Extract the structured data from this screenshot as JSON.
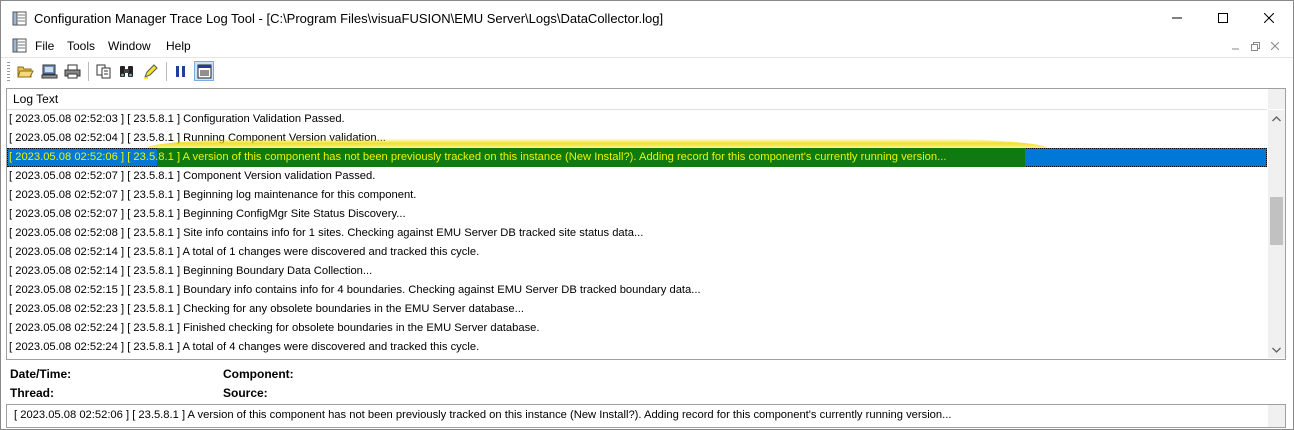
{
  "window": {
    "title": "Configuration Manager Trace Log Tool - [C:\\Program Files\\visuaFUSION\\EMU Server\\Logs\\DataCollector.log]"
  },
  "menu": {
    "items": [
      {
        "label": "File"
      },
      {
        "label": "Tools"
      },
      {
        "label": "Window"
      },
      {
        "label": "Help"
      }
    ]
  },
  "list": {
    "column_header": "Log Text",
    "rows": [
      {
        "text": "[ 2023.05.08 02:52:03 ] [ 23.5.8.1 ] Configuration Validation Passed."
      },
      {
        "text": "[ 2023.05.08 02:52:04 ] [ 23.5.8.1 ] Running Component Version validation..."
      },
      {
        "text": "[ 2023.05.08 02:52:06 ] [ 23.5.8.1 ] A version of this component has not been previously tracked on this instance (New Install?).  Adding record for this component's currently running version...",
        "selected": true
      },
      {
        "text": "[ 2023.05.08 02:52:07 ] [ 23.5.8.1 ] Component Version validation Passed."
      },
      {
        "text": "[ 2023.05.08 02:52:07 ] [ 23.5.8.1 ] Beginning log maintenance for this component."
      },
      {
        "text": "[ 2023.05.08 02:52:07 ] [ 23.5.8.1 ] Beginning ConfigMgr Site Status Discovery..."
      },
      {
        "text": "[ 2023.05.08 02:52:08 ] [ 23.5.8.1 ] Site info contains info for 1 sites.  Checking against EMU Server DB tracked site status data..."
      },
      {
        "text": "[ 2023.05.08 02:52:14 ] [ 23.5.8.1 ] A total of 1 changes were discovered and tracked this cycle."
      },
      {
        "text": "[ 2023.05.08 02:52:14 ] [ 23.5.8.1 ] Beginning Boundary Data Collection..."
      },
      {
        "text": "[ 2023.05.08 02:52:15 ] [ 23.5.8.1 ] Boundary info contains info for 4 boundaries.  Checking against EMU Server DB tracked boundary data..."
      },
      {
        "text": "[ 2023.05.08 02:52:23 ] [ 23.5.8.1 ] Checking for any obsolete boundaries in the EMU Server database..."
      },
      {
        "text": "[ 2023.05.08 02:52:24 ] [ 23.5.8.1 ] Finished checking for obsolete boundaries in the EMU Server database."
      },
      {
        "text": "[ 2023.05.08 02:52:24 ] [ 23.5.8.1 ] A total of 4 changes were discovered and tracked this cycle."
      }
    ]
  },
  "details": {
    "datetime_label": "Date/Time:",
    "component_label": "Component:",
    "thread_label": "Thread:",
    "source_label": "Source:",
    "message": "[ 2023.05.08 02:52:06 ] [ 23.5.8.1 ] A version of this component has not been previously tracked on this instance (New Install?).  Adding record for this component's currently running version..."
  },
  "colors": {
    "selection": "#0078d7",
    "highlight_green": "#0f7a0f",
    "highlight_yellow": "#e8f500"
  }
}
